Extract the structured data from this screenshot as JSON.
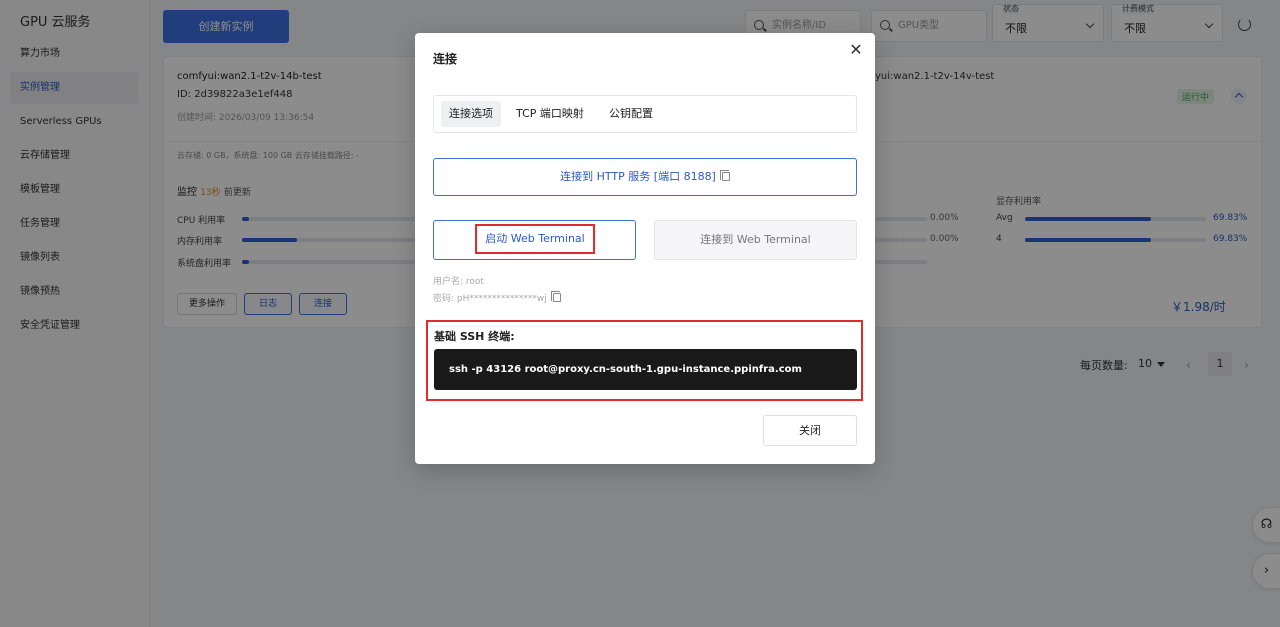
{
  "sidebar": {
    "brand": "GPU 云服务",
    "items": [
      {
        "label": "算力市场"
      },
      {
        "label": "实例管理"
      },
      {
        "label": "Serverless GPUs"
      },
      {
        "label": "云存储管理"
      },
      {
        "label": "模板管理"
      },
      {
        "label": "任务管理"
      },
      {
        "label": "镜像列表"
      },
      {
        "label": "镜像预热"
      },
      {
        "label": "安全凭证管理"
      }
    ]
  },
  "toolbar": {
    "create_label": "创建新实例",
    "search_placeholder": "实例名称/ID",
    "gpu_placeholder": "GPU类型",
    "status_label": "状态",
    "status_value": "不限",
    "billing_label": "计费模式",
    "billing_value": "不限"
  },
  "instance": {
    "name": "comfyui:wan2.1-t2v-14b-test",
    "id": "ID: 2d39822a3e1ef448",
    "created": "创建时间: 2026/03/09 13:36:54",
    "name2": "yui:wan2.1-t2v-14v-test",
    "status": "运行中",
    "storage": "云存储: 0 GB，系统盘: 100 GB    云存储挂载路径: -",
    "monitor_title": "监控",
    "monitor_seconds": "13秒",
    "monitor_updated": "前更新",
    "metrics": [
      {
        "label": "CPU 利用率",
        "value": 0.01,
        "pct_text": "0.00%"
      },
      {
        "label": "内存利用率",
        "value": 0.08,
        "pct_text": "0.00%"
      },
      {
        "label": "系统盘利用率",
        "value": 0.01,
        "pct_text": ""
      }
    ],
    "vram_title": "显存利用率",
    "vram": [
      {
        "label": "Avg",
        "value": 0.6983,
        "pct_text": "69.83%"
      },
      {
        "label": "4",
        "value": 0.6983,
        "pct_text": "69.83%"
      }
    ],
    "btn_more": "更多操作",
    "btn_log": "日志",
    "btn_connect": "连接",
    "price": "￥1.98/时"
  },
  "pager": {
    "per_page_label": "每页数量:",
    "per_page_value": "10",
    "prev": "‹",
    "page": "1",
    "next": "›"
  },
  "float": {
    "support_icon": "headset-icon",
    "expand_icon": "chevron-right-icon",
    "support_glyph": "☊",
    "expand_glyph": "›"
  },
  "modal": {
    "title": "连接",
    "close_glyph": "✕",
    "tabs": [
      {
        "label": "连接选项"
      },
      {
        "label": "TCP 端口映射"
      },
      {
        "label": "公钥配置"
      }
    ],
    "http_button": "连接到 HTTP 服务 [端口 8188]",
    "launch_terminal": "启动 Web Terminal",
    "connect_terminal": "连接到 Web Terminal",
    "username": "用户名: root",
    "password": "密码: pH***************wj",
    "ssh_title": "基础 SSH 终端:",
    "ssh_command": "ssh -p 43126 root@proxy.cn-south-1.gpu-instance.ppinfra.com",
    "close_button": "关闭"
  },
  "colors": {
    "accent": "#3d6fe0",
    "highlight_border": "#e02c2c",
    "running_badge": "#3aa45a"
  }
}
